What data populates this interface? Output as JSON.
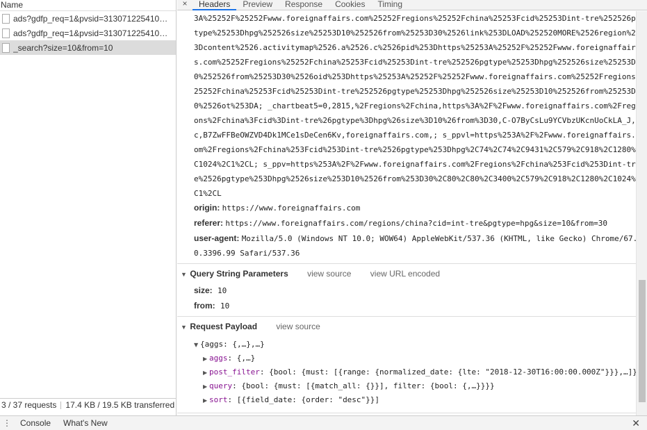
{
  "left_panel": {
    "header": "Name",
    "requests": [
      {
        "name": "ads?gdfp_req=1&pvsid=31307122541083..."
      },
      {
        "name": "ads?gdfp_req=1&pvsid=31307122541083..."
      },
      {
        "name": "_search?size=10&from=10"
      }
    ],
    "status": {
      "requests": "3 / 37 requests",
      "transferred": "17.4 KB / 19.5 KB transferred"
    }
  },
  "tabs": {
    "close_icon": "×",
    "items": [
      "Headers",
      "Preview",
      "Response",
      "Cookies",
      "Timing"
    ],
    "active": "Headers"
  },
  "cookie_lines": [
    "3A%25252F%25252Fwww.foreignaffairs.com%25252Fregions%25252Fchina%25253Fcid%25253Dint-tre%252526pg",
    "type%25253Dhpg%252526size%25253D10%252526from%25253D30%2526link%253DLOAD%252520MORE%2526region%25",
    "3Dcontent%2526.activitymap%2526.a%2526.c%2526pid%253Dhttps%25253A%25252F%25252Fwww.foreignaffair",
    "s.com%25252Fregions%25252Fchina%25253Fcid%25253Dint-tre%252526pgtype%25253Dhpg%252526size%25253D",
    "0%252526from%25253D30%2526oid%253Dhttps%25253A%25252F%25252Fwww.foreignaffairs.com%25252Fregions%",
    "25252Fchina%25253Fcid%25253Dint-tre%252526pgtype%25253Dhpg%252526size%25253D10%252526from%25253D3",
    "0%2526ot%253DA; _chartbeat5=0,2815,%2Fregions%2Fchina,https%3A%2F%2Fwww.foreignaffairs.com%2Freg",
    "ons%2Fchina%3Fcid%3Dint-tre%26pgtype%3Dhpg%26size%3D10%26from%3D30,C-O7ByCsLu9YCVbzUKcnUoCkLA_J,",
    "c,B7ZwFFBeOWZVD4Dk1MCe1sDeCen6Kv,foreignaffairs.com,; s_ppvl=https%253A%2F%2Fwww.foreignaffairs.",
    "om%2Fregions%2Fchina%253Fcid%253Dint-tre%2526pgtype%253Dhpg%2C74%2C74%2C9431%2C579%2C918%2C1280%",
    "C1024%2C1%2CL; s_ppv=https%253A%2F%2Fwww.foreignaffairs.com%2Fregions%2Fchina%253Fcid%253Dint-tr",
    "e%2526pgtype%253Dhpg%2526size%253D10%2526from%253D30%2C80%2C80%2C3400%2C579%2C918%2C1280%2C1024%",
    "C1%2CL"
  ],
  "headers": [
    {
      "key": "origin:",
      "value": "https://www.foreignaffairs.com"
    },
    {
      "key": "referer:",
      "value": "https://www.foreignaffairs.com/regions/china?cid=int-tre&pgtype=hpg&size=10&from=30"
    },
    {
      "key": "user-agent:",
      "value": "Mozilla/5.0 (Windows NT 10.0; WOW64) AppleWebKit/537.36 (KHTML, like Gecko) Chrome/67."
    },
    {
      "key": "",
      "value": "0.3396.99 Safari/537.36"
    }
  ],
  "query_section": {
    "title": "Query String Parameters",
    "view_source": "view source",
    "view_url_encoded": "view URL encoded",
    "params": [
      {
        "key": "size:",
        "value": "10"
      },
      {
        "key": "from:",
        "value": "10"
      }
    ]
  },
  "payload_section": {
    "title": "Request Payload",
    "view_source": "view source",
    "root": "{aggs: {,…},…}",
    "children": [
      {
        "key": "aggs",
        "value": ": {,…}"
      },
      {
        "key": "post_filter",
        "value": ": {bool: {must: [{range: {normalized_date: {lte: \"2018-12-30T16:00:00.000Z\"}}},…]}"
      },
      {
        "key": "query",
        "value": ": {bool: {must: [{match_all: {}}], filter: {bool: {,…}}}}"
      },
      {
        "key": "sort",
        "value": ": [{field_date: {order: \"desc\"}}]"
      }
    ]
  },
  "drawer": {
    "menu_icon": "⋮",
    "tabs": [
      "Console",
      "What's New"
    ],
    "close_icon": "✕"
  },
  "colors": {
    "active_tab_underline": "#1a73e8",
    "selected_row": "#dcdcdc",
    "property_key": "#881391"
  }
}
